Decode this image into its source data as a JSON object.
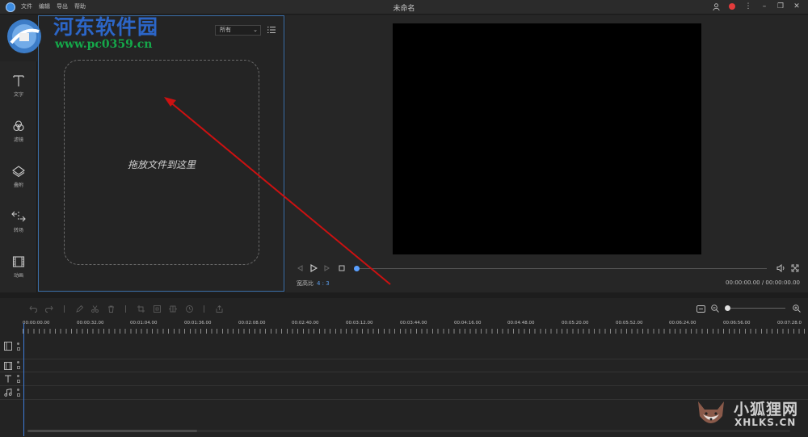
{
  "titlebar": {
    "title": "未命名",
    "menu": [
      "文件",
      "编辑",
      "导出",
      "帮助"
    ]
  },
  "watermark": {
    "site_name": "河东软件园",
    "url": "www.pc0359.cn",
    "corner_cn": "小狐狸网",
    "corner_en": "XHLKS.CN"
  },
  "rail": {
    "items": [
      {
        "label": "文字",
        "icon": "text-icon"
      },
      {
        "label": "滤镜",
        "icon": "filter-icon"
      },
      {
        "label": "叠附",
        "icon": "overlay-icon"
      },
      {
        "label": "转场",
        "icon": "transition-icon"
      },
      {
        "label": "动画",
        "icon": "animation-icon"
      }
    ]
  },
  "media": {
    "filter_value": "所有",
    "drop_text": "拖放文件到这里"
  },
  "preview": {
    "aspect_label": "宽高比",
    "aspect_value": "4 : 3",
    "timecode": "00:00:00.00 / 00:00:00.00"
  },
  "timeline": {
    "ruler": [
      "00:00:00.00",
      "00:00:32.00",
      "00:01:04.00",
      "00:01:36.00",
      "00:02:08.00",
      "00:02:40.00",
      "00:03:12.00",
      "00:03:44.00",
      "00:04:16.00",
      "00:04:48.00",
      "00:05:20.00",
      "00:05:52.00",
      "00:06:24.00",
      "00:06:56.00",
      "00:07:28.0"
    ]
  },
  "colors": {
    "accent": "#5aa0ff",
    "panel_border": "#3a6ea8",
    "annotation_arrow": "#cc1111"
  }
}
